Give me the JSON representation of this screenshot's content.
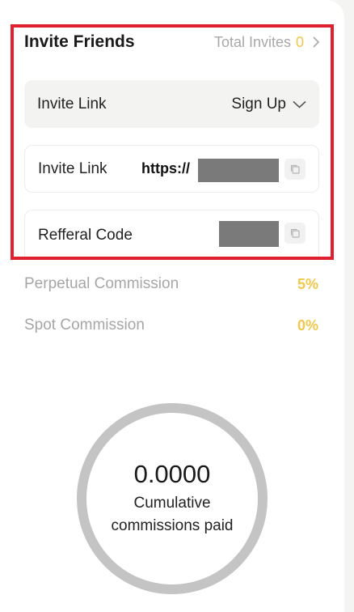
{
  "header": {
    "title": "Invite Friends",
    "total_invites_label": "Total Invites",
    "total_invites_count": "0"
  },
  "link_type": {
    "label": "Invite Link",
    "selected": "Sign Up"
  },
  "invite_link": {
    "label": "Invite Link",
    "url_prefix": "https://"
  },
  "referral": {
    "label": "Refferal Code"
  },
  "commissions": [
    {
      "label": "Perpetual Commission",
      "value": "5%"
    },
    {
      "label": "Spot Commission",
      "value": "0%"
    }
  ],
  "summary": {
    "value": "0.0000",
    "caption": "Cumulative commissions paid"
  },
  "colors": {
    "accent": "#f2c84b",
    "highlight": "#e0202e",
    "ring": "#c4c4c4"
  }
}
